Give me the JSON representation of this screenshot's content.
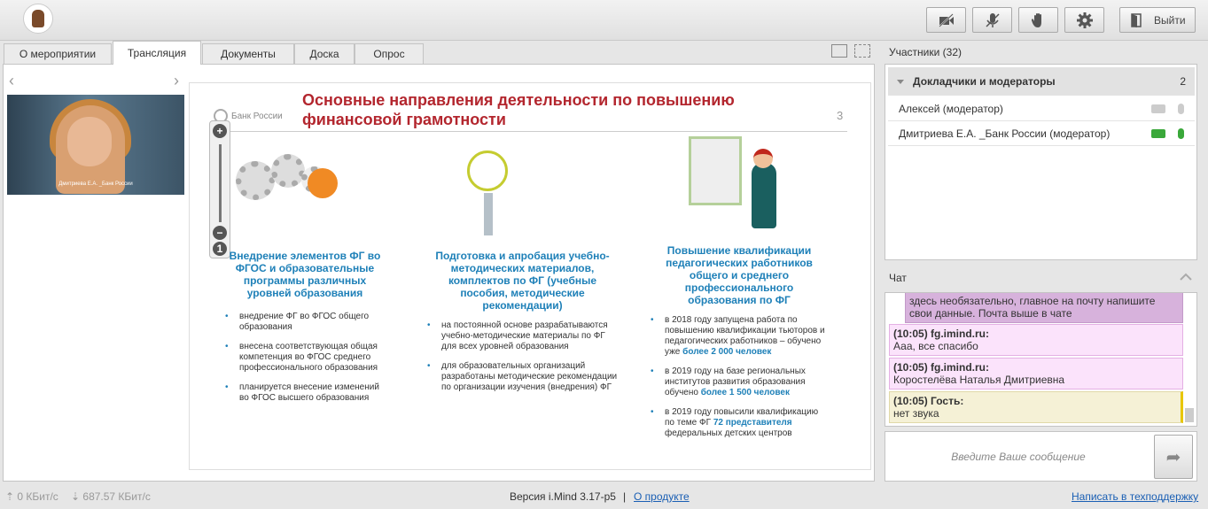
{
  "toolbar": {
    "buttons": [
      {
        "name": "camera-off-icon",
        "label": ""
      },
      {
        "name": "microphone-off-icon",
        "label": ""
      },
      {
        "name": "raise-hand-icon",
        "label": ""
      },
      {
        "name": "settings-gear-icon",
        "label": ""
      }
    ],
    "exit_label": "Выйти"
  },
  "tabs": [
    {
      "label": "О мероприятии",
      "active": false
    },
    {
      "label": "Трансляция",
      "active": true
    },
    {
      "label": "Документы",
      "active": false
    },
    {
      "label": "Доска",
      "active": false
    },
    {
      "label": "Опрос",
      "active": false
    }
  ],
  "slide": {
    "bank": "Банк России",
    "title": "Основные направления деятельности по повышению финансовой грамотности",
    "number": "3",
    "columns": [
      {
        "title": "Внедрение элементов ФГ во ФГОС и образовательные программы различных уровней образования",
        "bullets": [
          {
            "text": "внедрение ФГ во ФГОС общего образования"
          },
          {
            "text": "внесена соответствующая общая компетенция во ФГОС среднего профессионального образования"
          },
          {
            "text": "планируется внесение изменений во ФГОС высшего образования"
          }
        ]
      },
      {
        "title": "Подготовка и апробация учебно-методических материалов, комплектов по ФГ (учебные пособия, методические рекомендации)",
        "bullets": [
          {
            "text": "на постоянной основе разрабатываются учебно-методические материалы по ФГ для всех уровней образования"
          },
          {
            "text": "для образовательных организаций разработаны методические рекомендации по организации изучения (внедрения) ФГ"
          }
        ]
      },
      {
        "title": "Повышение квалификации педагогических работников общего и среднего профессионального образования по ФГ",
        "bullets": [
          {
            "text": "в 2018 году запущена работа по повышению квалификации тьюторов и педагогических работников – обучено уже",
            "highlight": "более 2 000 человек",
            "after": ""
          },
          {
            "text": "в 2019 году на базе региональных институтов развития образования обучено",
            "highlight": "более 1 500 человек",
            "after": ""
          },
          {
            "text": "в 2019 году повысили квалификацию по теме ФГ",
            "highlight": "72 представителя",
            "after": "федеральных детских центров"
          }
        ]
      }
    ]
  },
  "participants": {
    "header": "Участники (32)",
    "group_label": "Докладчики и модераторы",
    "group_count": "2",
    "items": [
      {
        "name": "Алексей (модератор)",
        "active": false
      },
      {
        "name": "Дмитриева Е.А. _Банк России (модератор)",
        "active": true
      }
    ]
  },
  "chat": {
    "header": "Чат",
    "messages": [
      {
        "author": "",
        "text": "здесь необязательно, главное на почту напишите свои данные. Почта выше в чате",
        "style": "purple"
      },
      {
        "author": "(10:05) fg.imind.ru:",
        "text": "Ааа, все спасибо",
        "style": "pink"
      },
      {
        "author": "(10:05) fg.imind.ru:",
        "text": "Коростелёва Наталья Дмитриевна",
        "style": "pink"
      },
      {
        "author": "(10:05) Гость:",
        "text": "нет звука",
        "style": "yellow"
      }
    ],
    "input_placeholder": "Введите Ваше сообщение"
  },
  "status": {
    "up": "0 КБит/с",
    "down": "687.57 КБит/с",
    "version": "Версия i.Mind 3.17-p5",
    "separator": "|",
    "about": "О продукте",
    "support": "Написать в техподдержку"
  },
  "video": {
    "caption": "Дмитриева Е.А. _Банк России"
  },
  "colors": {
    "accent": "#1e80b8",
    "title_red": "#b3262e",
    "mic_green": "#3aa83a",
    "chat_pink": "#fbe3fb",
    "chat_purple": "#d7b2dc",
    "chat_yellow": "#f5f1d6"
  }
}
